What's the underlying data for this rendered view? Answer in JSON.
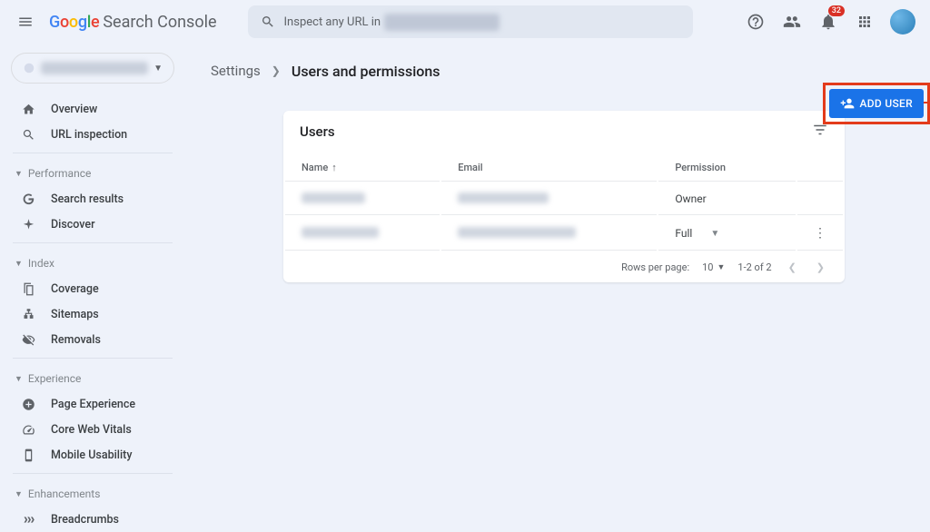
{
  "header": {
    "product_name": "Search Console",
    "search_placeholder_prefix": "Inspect any URL in",
    "notification_count": "32"
  },
  "sidebar": {
    "items_top": [
      {
        "label": "Overview",
        "icon": "home"
      },
      {
        "label": "URL inspection",
        "icon": "search"
      }
    ],
    "section_performance": "Performance",
    "items_performance": [
      {
        "label": "Search results",
        "icon": "g"
      },
      {
        "label": "Discover",
        "icon": "spark"
      }
    ],
    "section_index": "Index",
    "items_index": [
      {
        "label": "Coverage",
        "icon": "pages"
      },
      {
        "label": "Sitemaps",
        "icon": "sitemap"
      },
      {
        "label": "Removals",
        "icon": "remove"
      }
    ],
    "section_experience": "Experience",
    "items_experience": [
      {
        "label": "Page Experience",
        "icon": "plus-circle"
      },
      {
        "label": "Core Web Vitals",
        "icon": "speed"
      },
      {
        "label": "Mobile Usability",
        "icon": "phone"
      }
    ],
    "section_enhancements": "Enhancements",
    "items_enhancements": [
      {
        "label": "Breadcrumbs",
        "icon": "bread"
      }
    ]
  },
  "breadcrumb": {
    "parent": "Settings",
    "current": "Users and permissions"
  },
  "add_user_button": "ADD USER",
  "card": {
    "title": "Users",
    "columns": {
      "name": "Name",
      "email": "Email",
      "permission": "Permission"
    },
    "rows": [
      {
        "permission": "Owner",
        "has_dropdown": false,
        "has_menu": false
      },
      {
        "permission": "Full",
        "has_dropdown": true,
        "has_menu": true
      }
    ],
    "footer": {
      "rows_per_page_label": "Rows per page:",
      "rows_per_page_value": "10",
      "range_text": "1-2 of 2"
    }
  }
}
